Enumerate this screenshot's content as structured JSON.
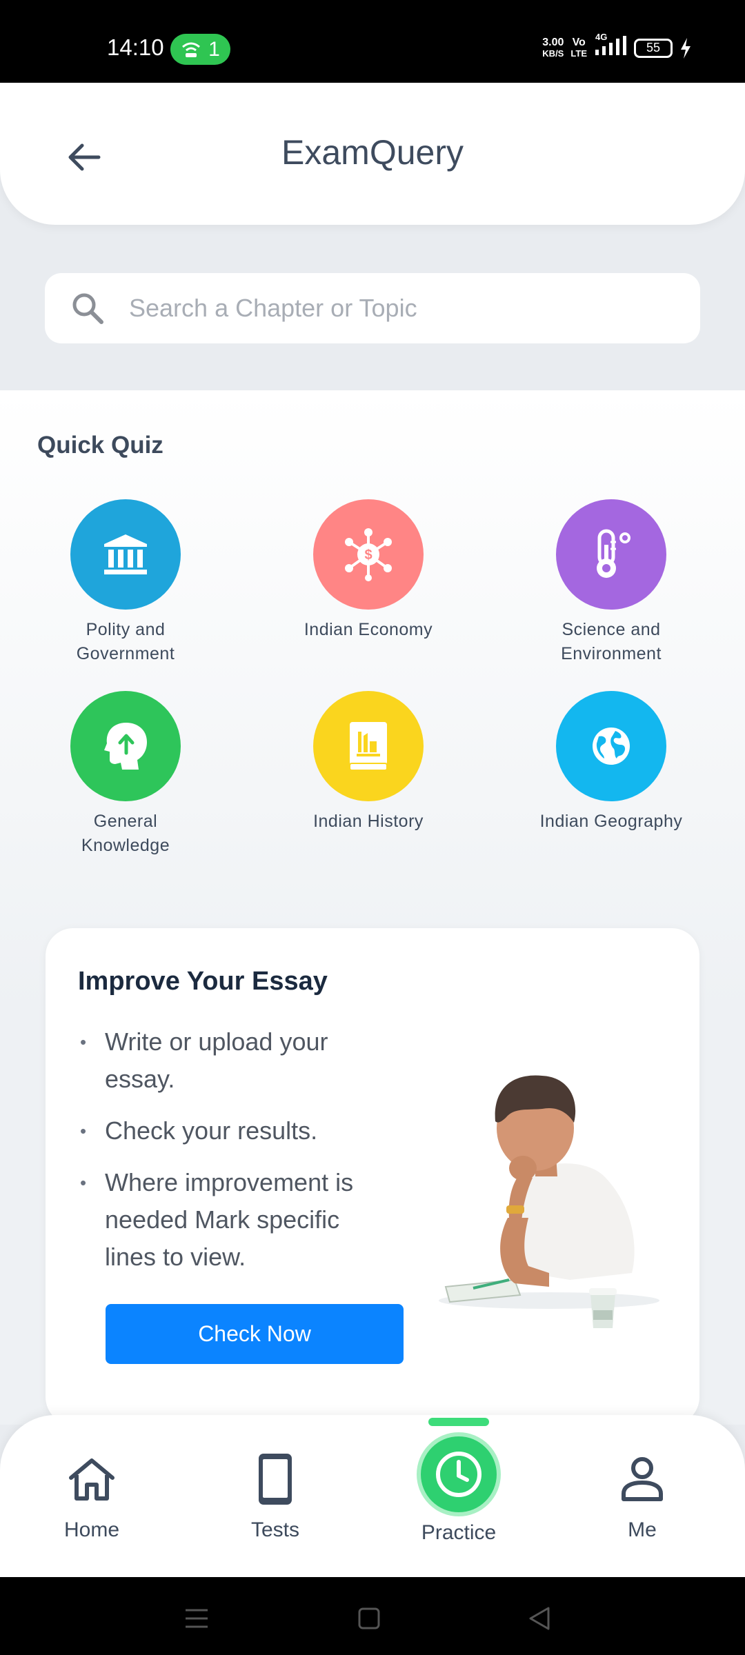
{
  "status_bar": {
    "time": "14:10",
    "hotspot_count": "1",
    "net_speed_value": "3.00",
    "net_speed_unit": "KB/S",
    "volte_top": "Vo",
    "volte_bottom": "LTE",
    "network_type": "4G",
    "battery": "55"
  },
  "header": {
    "title": "ExamQuery",
    "back_icon": "arrow-left-icon"
  },
  "search": {
    "placeholder": "Search a Chapter or Topic",
    "value": ""
  },
  "quick_quiz": {
    "title": "Quick Quiz",
    "items": [
      {
        "label": "Polity and\nGovernment",
        "color": "#1fa5db",
        "icon": "government-building-icon"
      },
      {
        "label": "Indian Economy",
        "color": "#ff8585",
        "icon": "economy-network-icon"
      },
      {
        "label": "Science and\nEnvironment",
        "color": "#a467e0",
        "icon": "thermometer-icon"
      },
      {
        "label": "General\nKnowledge",
        "color": "#2ec55a",
        "icon": "head-idea-icon"
      },
      {
        "label": "Indian History",
        "color": "#fad51e",
        "icon": "history-book-icon"
      },
      {
        "label": "Indian Geography",
        "color": "#13b7ef",
        "icon": "globe-icon"
      }
    ]
  },
  "essay_card": {
    "title": "Improve Your Essay",
    "points": [
      "Write or upload your essay.",
      "Check your results.",
      "Where improvement is needed Mark specific lines to view."
    ],
    "button_label": "Check Now"
  },
  "bottom_nav": {
    "items": [
      {
        "label": "Home",
        "icon": "home-icon",
        "active": false
      },
      {
        "label": "Tests",
        "icon": "phone-icon",
        "active": false
      },
      {
        "label": "Practice",
        "icon": "clock-icon",
        "active": true
      },
      {
        "label": "Me",
        "icon": "user-icon",
        "active": false
      }
    ],
    "active_color": "#2ed070"
  },
  "colors": {
    "primary_button": "#0b84ff",
    "title_text": "#3e4b5e",
    "background": "#e9ecf0"
  }
}
